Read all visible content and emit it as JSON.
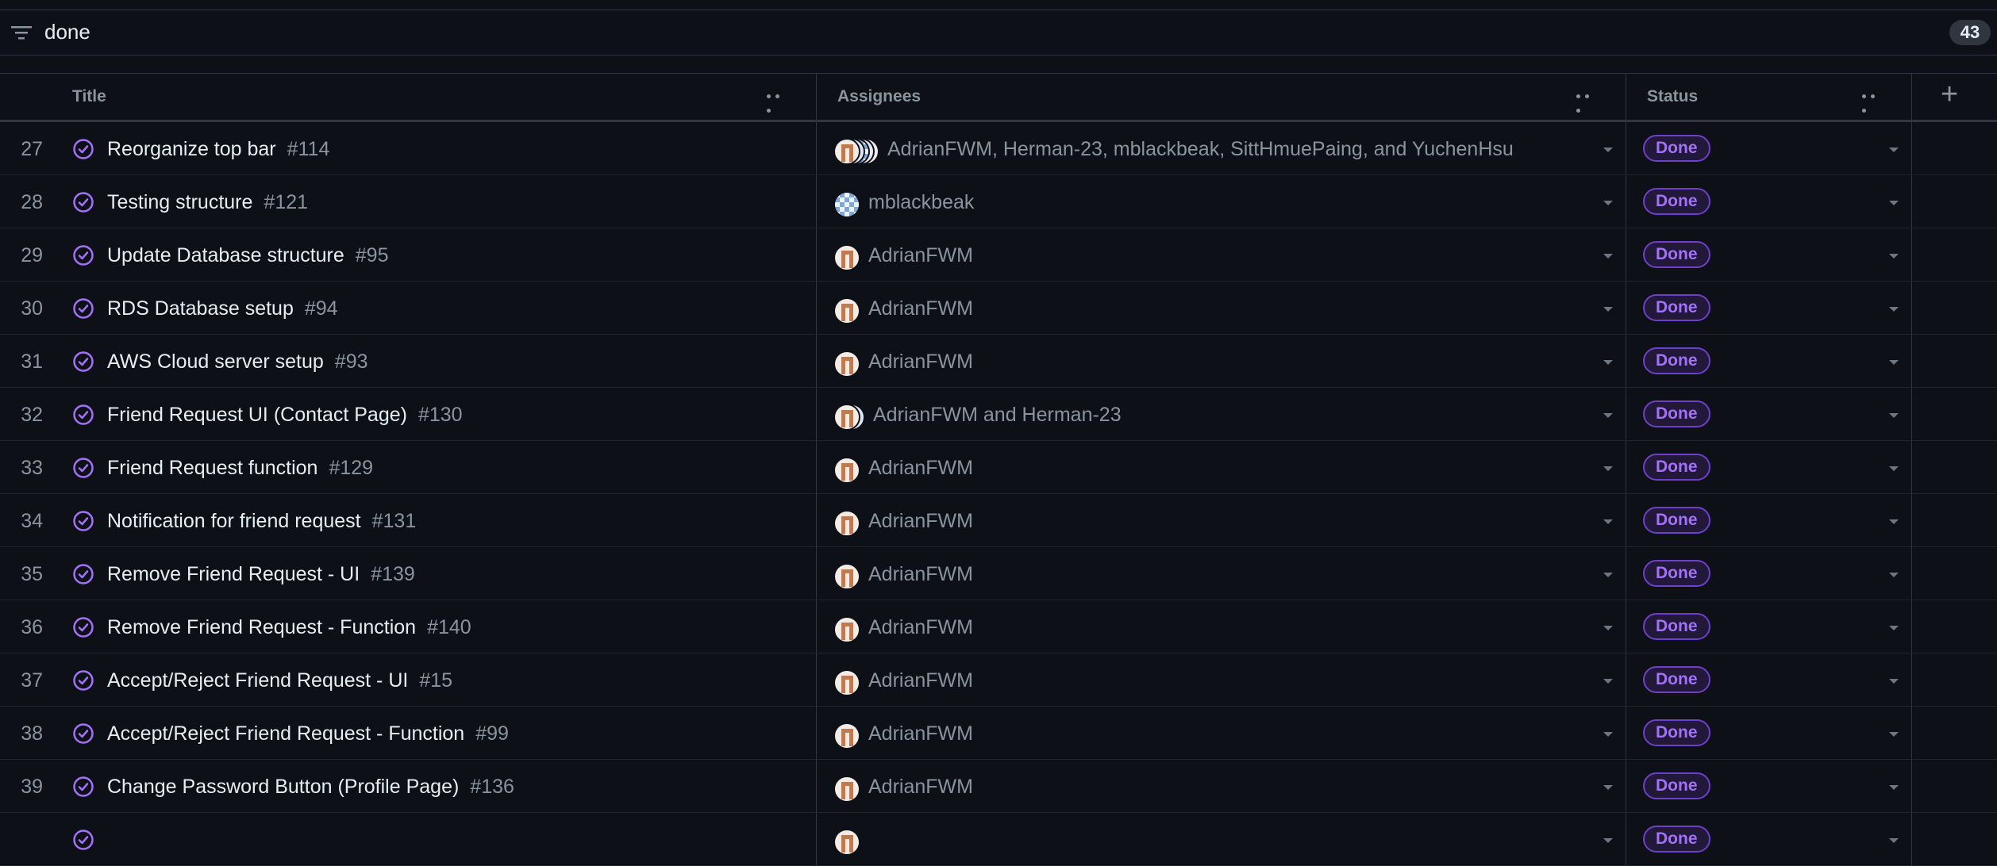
{
  "filter": {
    "query": "done",
    "count": "43"
  },
  "columns": {
    "title": "Title",
    "assignees": "Assignees",
    "status": "Status"
  },
  "colors": {
    "done_purple": "#a371f7",
    "background": "#0d1117"
  },
  "rows": [
    {
      "num": "27",
      "title": "Reorganize top bar",
      "issue": "#114",
      "assignees": "AdrianFWM, Herman-23, mblackbeak, SittHmuePaing, and YuchenHsu",
      "avatars": [
        "adrian",
        "herman",
        "mblackbeak",
        "sitt",
        "yuchen"
      ],
      "status": "Done"
    },
    {
      "num": "28",
      "title": "Testing structure",
      "issue": "#121",
      "assignees": "mblackbeak",
      "avatars": [
        "mblackbeak"
      ],
      "status": "Done"
    },
    {
      "num": "29",
      "title": "Update Database structure",
      "issue": "#95",
      "assignees": "AdrianFWM",
      "avatars": [
        "adrian"
      ],
      "status": "Done"
    },
    {
      "num": "30",
      "title": "RDS Database setup",
      "issue": "#94",
      "assignees": "AdrianFWM",
      "avatars": [
        "adrian"
      ],
      "status": "Done"
    },
    {
      "num": "31",
      "title": "AWS Cloud server setup",
      "issue": "#93",
      "assignees": "AdrianFWM",
      "avatars": [
        "adrian"
      ],
      "status": "Done"
    },
    {
      "num": "32",
      "title": "Friend Request UI (Contact Page)",
      "issue": "#130",
      "assignees": "AdrianFWM and Herman-23",
      "avatars": [
        "adrian",
        "herman"
      ],
      "status": "Done"
    },
    {
      "num": "33",
      "title": "Friend Request function",
      "issue": "#129",
      "assignees": "AdrianFWM",
      "avatars": [
        "adrian"
      ],
      "status": "Done"
    },
    {
      "num": "34",
      "title": "Notification for friend request",
      "issue": "#131",
      "assignees": "AdrianFWM",
      "avatars": [
        "adrian"
      ],
      "status": "Done"
    },
    {
      "num": "35",
      "title": "Remove Friend Request - UI",
      "issue": "#139",
      "assignees": "AdrianFWM",
      "avatars": [
        "adrian"
      ],
      "status": "Done"
    },
    {
      "num": "36",
      "title": "Remove Friend Request - Function",
      "issue": "#140",
      "assignees": "AdrianFWM",
      "avatars": [
        "adrian"
      ],
      "status": "Done"
    },
    {
      "num": "37",
      "title": "Accept/Reject Friend Request - UI",
      "issue": "#15",
      "assignees": "AdrianFWM",
      "avatars": [
        "adrian"
      ],
      "status": "Done"
    },
    {
      "num": "38",
      "title": "Accept/Reject Friend Request - Function",
      "issue": "#99",
      "assignees": "AdrianFWM",
      "avatars": [
        "adrian"
      ],
      "status": "Done"
    },
    {
      "num": "39",
      "title": "Change Password Button (Profile Page)",
      "issue": "#136",
      "assignees": "AdrianFWM",
      "avatars": [
        "adrian"
      ],
      "status": "Done"
    },
    {
      "num": "",
      "title": "",
      "issue": "",
      "assignees": "",
      "avatars": [
        "adrian"
      ],
      "status": "Done"
    }
  ]
}
